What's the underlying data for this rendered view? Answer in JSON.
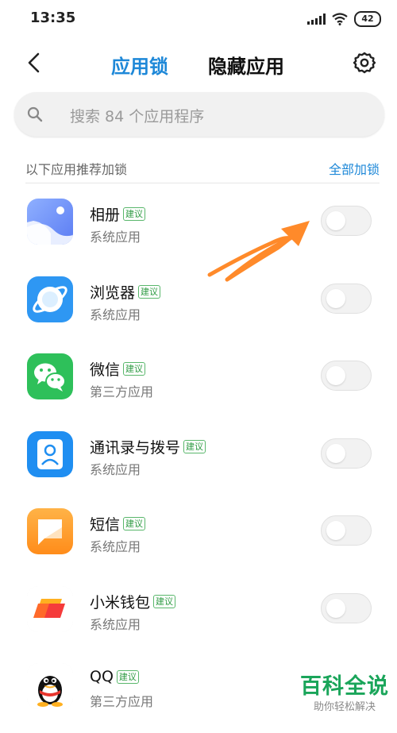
{
  "status_bar": {
    "time": "13:35",
    "battery": "42",
    "icons": [
      "signal-icon",
      "wifi-icon",
      "battery-icon"
    ]
  },
  "header": {
    "tabs": [
      {
        "label": "应用锁",
        "active": true
      },
      {
        "label": "隐藏应用",
        "active": false
      }
    ],
    "accent_color": "#1e88d8"
  },
  "search": {
    "placeholder": "搜索 84 个应用程序"
  },
  "section": {
    "label": "以下应用推荐加锁",
    "action": "全部加锁"
  },
  "apps": [
    {
      "name": "相册",
      "badge": "建议",
      "type": "系统应用",
      "icon": "gallery-icon",
      "locked": false
    },
    {
      "name": "浏览器",
      "badge": "建议",
      "type": "系统应用",
      "icon": "browser-icon",
      "locked": false
    },
    {
      "name": "微信",
      "badge": "建议",
      "type": "第三方应用",
      "icon": "wechat-icon",
      "locked": false
    },
    {
      "name": "通讯录与拨号",
      "badge": "建议",
      "type": "系统应用",
      "icon": "contacts-icon",
      "locked": false
    },
    {
      "name": "短信",
      "badge": "建议",
      "type": "系统应用",
      "icon": "messages-icon",
      "locked": false
    },
    {
      "name": "小米钱包",
      "badge": "建议",
      "type": "系统应用",
      "icon": "wallet-icon",
      "locked": false
    },
    {
      "name": "QQ",
      "badge": "建议",
      "type": "第三方应用",
      "icon": "qq-icon",
      "locked": false
    }
  ],
  "watermark": {
    "main": "百科全说",
    "sub": "助你轻松解决"
  }
}
